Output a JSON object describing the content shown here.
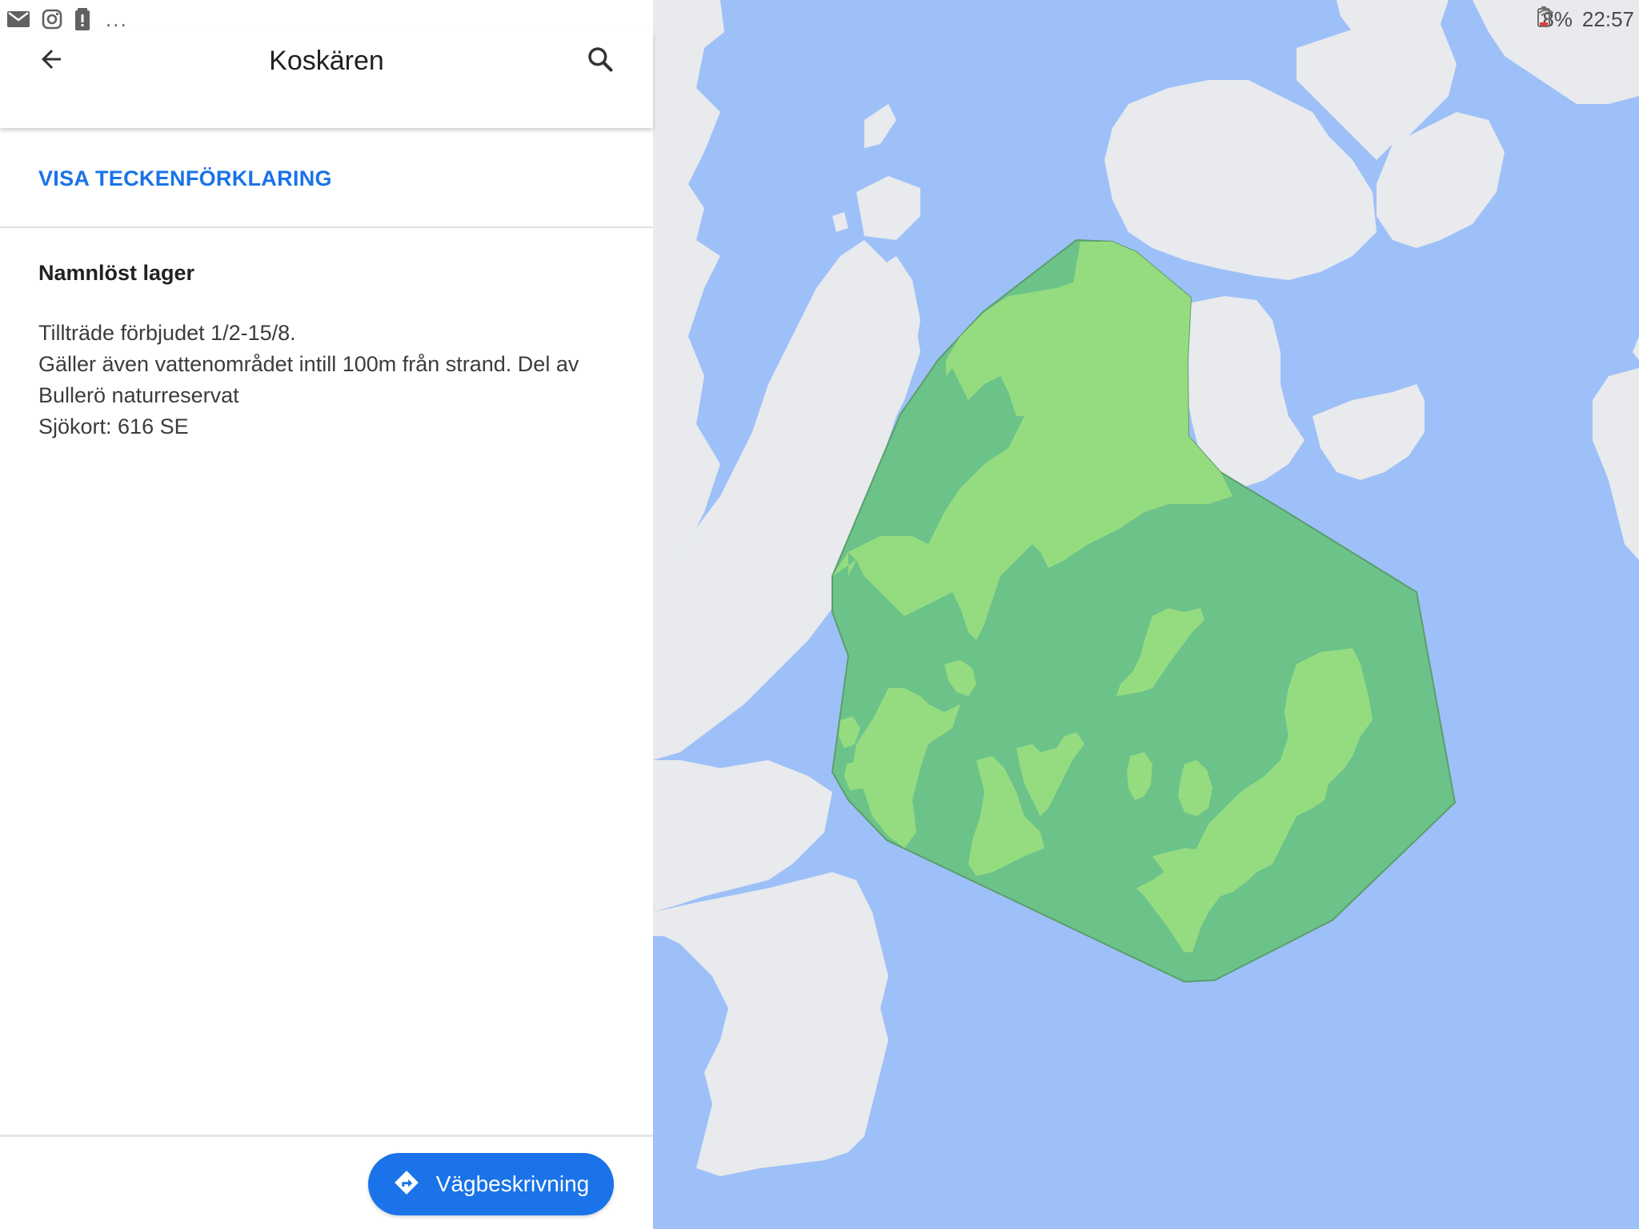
{
  "status_bar": {
    "icons_left": [
      "mail-icon",
      "instagram-icon",
      "alert-icon"
    ],
    "more": "...",
    "battery_percent": "8%",
    "time": "22:57"
  },
  "header": {
    "title": "Koskären",
    "back_icon": "arrow-back-icon",
    "search_icon": "search-icon"
  },
  "legend_link": "VISA TECKENFÖRKLARING",
  "layer": {
    "name": "Namnlöst lager",
    "description_lines": [
      "Tillträde förbjudet 1/2-15/8.",
      "Gäller även vattenområdet intill 100m från strand. Del av",
      "Bullerö naturreservat",
      "Sjökort: 616 SE"
    ]
  },
  "directions_button": {
    "label": "Vägbeskrivning",
    "icon": "directions-icon"
  },
  "map": {
    "colors": {
      "water": "#9ec0f8",
      "land": "#e8eaed",
      "polygon_fill": "#6cc38a",
      "polygon_stroke": "#5b9e6a",
      "island_green": "#95dc80"
    }
  }
}
